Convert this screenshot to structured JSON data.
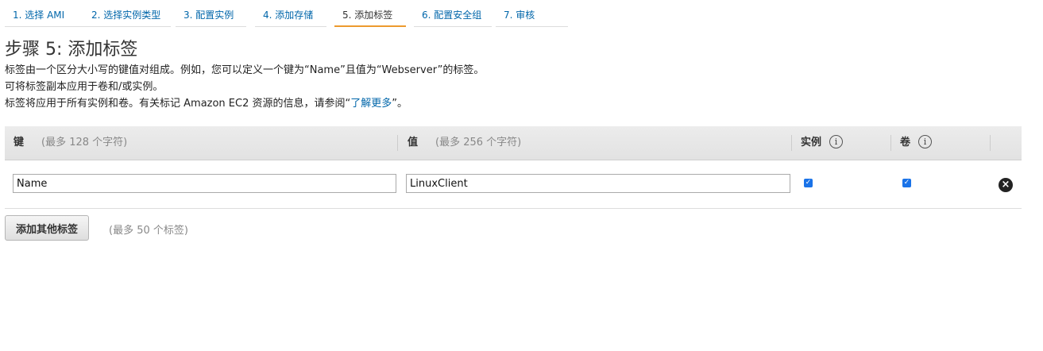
{
  "steps": [
    {
      "label": "1. 选择 AMI"
    },
    {
      "label": "2. 选择实例类型"
    },
    {
      "label": "3. 配置实例"
    },
    {
      "label": "4. 添加存储"
    },
    {
      "label": "5. 添加标签",
      "active": true
    },
    {
      "label": "6. 配置安全组"
    },
    {
      "label": "7. 审核"
    }
  ],
  "page": {
    "title": "步骤 5: 添加标签",
    "desc_line1": "标签由一个区分大小写的键值对组成。例如，您可以定义一个键为“Name”且值为“Webserver”的标签。",
    "desc_line2": "可将标签副本应用于卷和/或实例。",
    "desc_line3_prefix": "标签将应用于所有实例和卷。有关标记 Amazon EC2 资源的信息，请参阅“",
    "desc_line3_link": "了解更多",
    "desc_line3_suffix": "”。"
  },
  "table": {
    "col_key": "键",
    "col_key_hint": "(最多 128 个字符)",
    "col_value": "值",
    "col_value_hint": "(最多 256 个字符)",
    "col_instances": "实例",
    "col_volumes": "卷",
    "info_glyph": "i",
    "rows": [
      {
        "key": "Name",
        "value": "LinuxClient",
        "instances": true,
        "volumes": true
      }
    ],
    "remove_glyph": "×"
  },
  "actions": {
    "add_tag_label": "添加其他标签",
    "add_tag_hint": "(最多 50 个标签)"
  },
  "colors": {
    "link": "#0066aa",
    "active_tab_underline": "#ec9a2e",
    "checkbox": "#1a73e8"
  }
}
